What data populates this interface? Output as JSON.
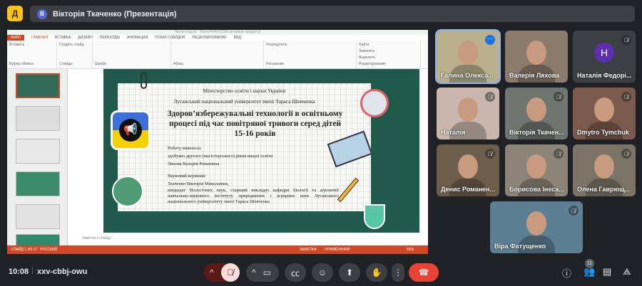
{
  "app": {
    "logo_letter": "Д",
    "title": "Вікторія Ткаченко (Презентація)",
    "presenter_initial": "В"
  },
  "powerpoint": {
    "window_title": "Презентація1 - PowerPoint (Сбій активації продукту)",
    "tabs": [
      "ФАЙЛ",
      "ГЛАВНАЯ",
      "ВСТАВКА",
      "ДИЗАЙН",
      "ПЕРЕХОДЫ",
      "АНИМАЦИЯ",
      "ПОКАЗ СЛАЙДОВ",
      "РЕЦЕНЗИРОВАНИЕ",
      "ВИД"
    ],
    "groups": [
      "Буфер обмена",
      "Слайды",
      "Шрифт",
      "Абзац",
      "Рисование",
      "Редактирование"
    ],
    "buttons": {
      "paste": "Вставить",
      "new_slide": "Создать слайд",
      "find": "Найти",
      "replace": "Заменить",
      "select": "Выделить",
      "arrange": "Упорядочить"
    },
    "notes_placeholder": "Заметки к слайду",
    "status_left": "СЛАЙД 1 ИЗ 17",
    "language": "РУССКИЙ",
    "status_notes": "ЗАМЕТКИ",
    "status_comments": "ПРИМЕЧАНИЯ",
    "zoom": "56%",
    "slide_numbers": [
      "1",
      "2",
      "3",
      "4",
      "5",
      "6"
    ]
  },
  "slide": {
    "ministry": "Міністерство освіти і науки України",
    "university": "Луганський національний університет імені Тараса Шевченка",
    "title_lines": [
      "Здоров’язбережувальні технології в освітньому",
      "процесі під час повітряної тривоги серед дітей",
      "15-16 років"
    ],
    "author_label": "Роботу виконала:",
    "author_degree": "здобувач другого (магістерського) рівня вищої освіти",
    "author_name": "Ляхова Валерія Романівна",
    "advisor_label": "Науковий керівник:",
    "advisor_name": "Ткаченко Вікторія Миколаївна,",
    "advisor_desc": "кандидат біологічних наук, старший викладач кафедри біології та агрономії навчально-наукового інституту природничих і аграрних наук Луганського національного університету імені Тараса Шевченка"
  },
  "participants": [
    {
      "name": "Галина Олекса...",
      "muted": false,
      "active": true,
      "color": "#b9b08e"
    },
    {
      "name": "Валерія Ляхова",
      "muted": false,
      "color": "#8a7b6d"
    },
    {
      "name": "Наталія Федорі...",
      "muted": true,
      "initial": "Н",
      "avatar_color": "#5b2fb0",
      "color": "#3c4043"
    },
    {
      "name": "Наталія",
      "muted": true,
      "color": "#c9b7ad"
    },
    {
      "name": "Вікторія Ткачен...",
      "muted": true,
      "color": "#6f7570"
    },
    {
      "name": "Dmytro Tymchuk",
      "muted": true,
      "color": "#7a5a4c"
    },
    {
      "name": "Денис Романен...",
      "muted": true,
      "color": "#6d5e4b"
    },
    {
      "name": "Борисова Інеса...",
      "muted": true,
      "color": "#8d8478"
    },
    {
      "name": "Олена Гаврющ...",
      "muted": true,
      "color": "#7b7466"
    },
    {
      "name": "Віра Фатущенко",
      "muted": true,
      "color": "#5c7f93"
    }
  ],
  "bottom": {
    "time": "10:08",
    "meeting_code": "xxv-cbbj-owu",
    "people_count": "11"
  },
  "colors": {
    "end_call": "#ea4335",
    "mic_off_bg": "#f9dedc",
    "ppt_accent": "#d24726",
    "chalkboard": "#1f5a4a"
  }
}
